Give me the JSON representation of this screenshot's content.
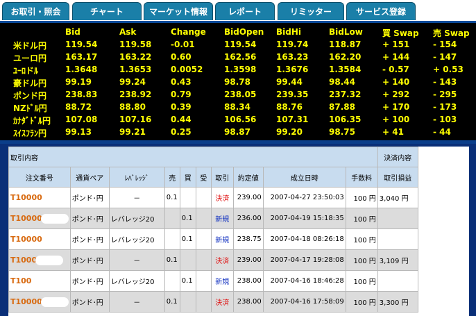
{
  "tabs": [
    "お取引・照会",
    "チャート",
    "マーケット情報",
    "レポート",
    "リミッター",
    "サービス登録"
  ],
  "quotes": {
    "headers": [
      "Bid",
      "Ask",
      "Change",
      "BidOpen",
      "BidHi",
      "BidLow",
      "買 Swap",
      "売 Swap"
    ],
    "rows": [
      {
        "pair": "米ドル円",
        "values": [
          "119.54",
          "119.58",
          "-0.01",
          "119.54",
          "119.74",
          "118.87",
          "+ 151",
          "- 154"
        ]
      },
      {
        "pair": "ユーロ円",
        "values": [
          "163.17",
          "163.22",
          "0.60",
          "162.56",
          "163.23",
          "162.20",
          "+ 144",
          "- 147"
        ]
      },
      {
        "pair": "ﾕｰﾛドﾙ",
        "values": [
          "1.3648",
          "1.3653",
          "0.0052",
          "1.3598",
          "1.3676",
          "1.3584",
          "- 0.57",
          "+ 0.53"
        ]
      },
      {
        "pair": "豪ドル円",
        "values": [
          "99.19",
          "99.24",
          "0.43",
          "98.78",
          "99.44",
          "98.44",
          "+ 140",
          "- 143"
        ]
      },
      {
        "pair": "ポンド円",
        "values": [
          "238.83",
          "238.92",
          "0.79",
          "238.05",
          "239.35",
          "237.32",
          "+ 292",
          "- 295"
        ]
      },
      {
        "pair": "NZﾄﾞﾙ円",
        "values": [
          "88.72",
          "88.80",
          "0.39",
          "88.34",
          "88.76",
          "87.88",
          "+ 170",
          "- 173"
        ]
      },
      {
        "pair": "ｶﾅﾀﾞﾄﾞﾙ円",
        "values": [
          "107.08",
          "107.16",
          "0.44",
          "106.56",
          "107.31",
          "106.35",
          "+ 100",
          "- 103"
        ]
      },
      {
        "pair": "ｽｲｽﾌﾗﾝ円",
        "values": [
          "99.13",
          "99.21",
          "0.25",
          "98.87",
          "99.20",
          "98.75",
          "+ 41",
          "- 44"
        ]
      }
    ]
  },
  "trades": {
    "section_left": "取引内容",
    "section_right": "決済内容",
    "columns": [
      "注文番号",
      "通貨ペア",
      "ﾚﾊﾞﾚｯｼﾞ",
      "売",
      "買",
      "受",
      "取引",
      "約定値",
      "成立日時",
      "手数料",
      "取引損益"
    ],
    "rows": [
      {
        "order": "T10000",
        "pair": "ポンド･円",
        "leverage": "－",
        "sell": "0.1",
        "buy": "",
        "recv": "",
        "type": "決済",
        "price": "239.00",
        "datetime": "2007-04-27 23:50:03",
        "fee": "100 円",
        "pnl": "3,040 円"
      },
      {
        "order": "T10000",
        "pair": "ポンド･円",
        "leverage": "レバレッジ20",
        "sell": "",
        "buy": "0.1",
        "recv": "",
        "type": "新規",
        "price": "236.00",
        "datetime": "2007-04-19 15:18:35",
        "fee": "100 円",
        "pnl": ""
      },
      {
        "order": "T10000",
        "pair": "ポンド･円",
        "leverage": "レバレッジ20",
        "sell": "",
        "buy": "0.1",
        "recv": "",
        "type": "新規",
        "price": "238.75",
        "datetime": "2007-04-18 08:26:18",
        "fee": "100 円",
        "pnl": ""
      },
      {
        "order": "T1000",
        "pair": "ポンド･円",
        "leverage": "－",
        "sell": "0.1",
        "buy": "",
        "recv": "",
        "type": "決済",
        "price": "239.00",
        "datetime": "2007-04-17 19:28:08",
        "fee": "100 円",
        "pnl": "3,109 円"
      },
      {
        "order": "T100",
        "pair": "ポンド･円",
        "leverage": "レバレッジ20",
        "sell": "",
        "buy": "0.1",
        "recv": "",
        "type": "新規",
        "price": "238.00",
        "datetime": "2007-04-16 18:46:28",
        "fee": "100 円",
        "pnl": ""
      },
      {
        "order": "T10000",
        "pair": "ポンド･円",
        "leverage": "－",
        "sell": "0.1",
        "buy": "",
        "recv": "",
        "type": "決済",
        "price": "238.00",
        "datetime": "2007-04-16 17:58:09",
        "fee": "100 円",
        "pnl": "3,300 円"
      }
    ]
  }
}
